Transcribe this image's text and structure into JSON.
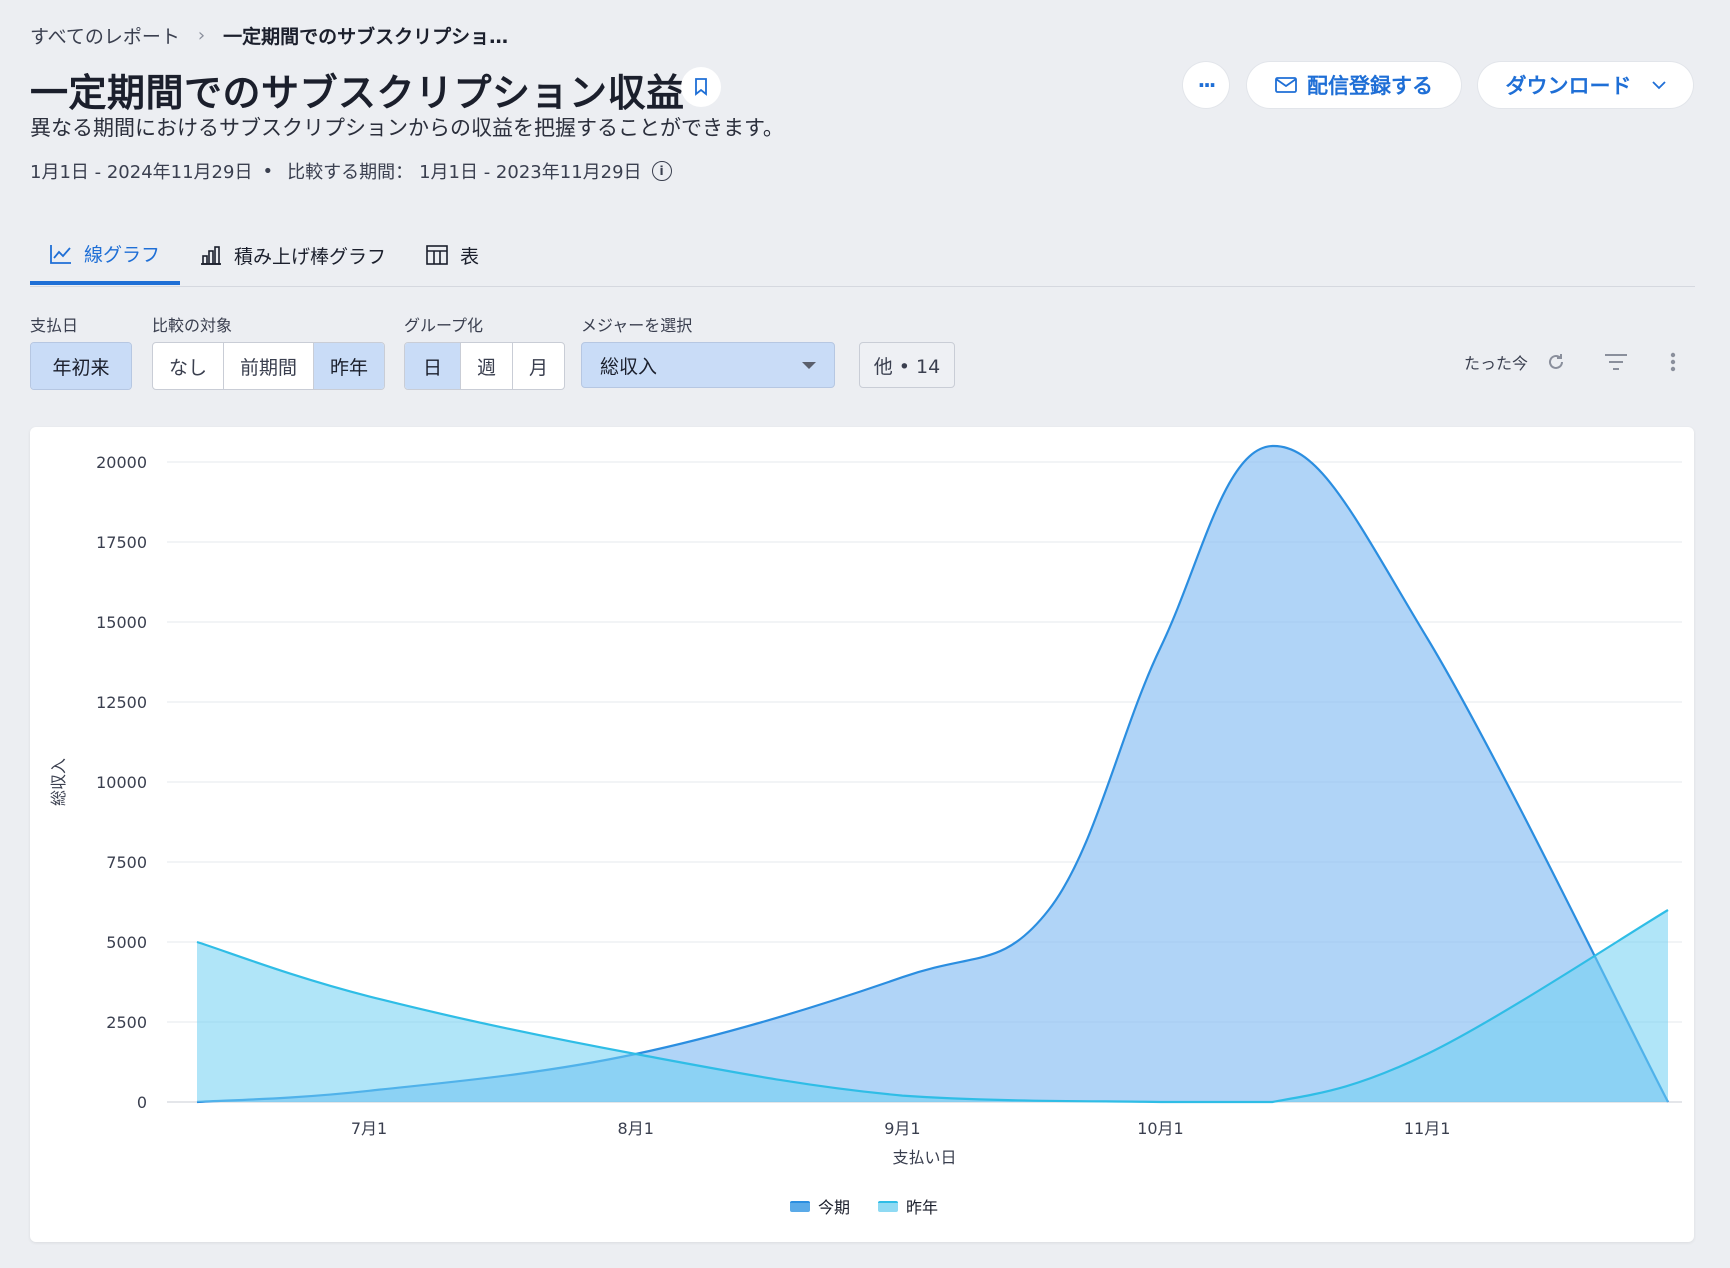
{
  "breadcrumb": {
    "root": "すべてのレポート",
    "current": "一定期間でのサブスクリプショ…"
  },
  "header": {
    "title": "一定期間でのサブスクリプション収益",
    "subtitle": "異なる期間におけるサブスクリプションからの収益を把握することができます。",
    "period": "1月1日 - 2024年11月29日",
    "compare_label": "比較する期間：",
    "compare_period": "1月1日 - 2023年11月29日",
    "more_label": "···",
    "subscribe_label": "配信登録する",
    "download_label": "ダウンロード"
  },
  "tabs": [
    {
      "label": "線グラフ",
      "icon": "line-chart-icon"
    },
    {
      "label": "積み上げ棒グラフ",
      "icon": "stacked-bar-icon"
    },
    {
      "label": "表",
      "icon": "table-icon"
    }
  ],
  "filters": {
    "payment_date": {
      "label": "支払日",
      "value": "年初来"
    },
    "compare": {
      "label": "比較の対象",
      "options": [
        "なし",
        "前期間",
        "昨年"
      ],
      "selected": "昨年"
    },
    "group": {
      "label": "グループ化",
      "options": [
        "日",
        "週",
        "月"
      ],
      "selected": "日"
    },
    "measure": {
      "label": "メジャーを選択",
      "value": "総収入"
    },
    "other": "他 • 14",
    "updated": "たった今"
  },
  "colors": {
    "accent": "#1f6fd6",
    "current": "#2b8ee0",
    "previous": "#2fbde6"
  },
  "chart_data": {
    "type": "area",
    "xlabel": "支払い日",
    "ylabel": "総収入",
    "ylim": [
      0,
      20000
    ],
    "yticks": [
      0,
      2500,
      5000,
      7500,
      10000,
      12500,
      15000,
      17500,
      20000
    ],
    "xticks": [
      {
        "label": "7月1",
        "date": "2024-07-01"
      },
      {
        "label": "8月1",
        "date": "2024-08-01"
      },
      {
        "label": "9月1",
        "date": "2024-09-01"
      },
      {
        "label": "10月1",
        "date": "2024-10-01"
      },
      {
        "label": "11月1",
        "date": "2024-11-01"
      }
    ],
    "series": [
      {
        "name": "今期",
        "points": [
          [
            "2024-06-11",
            0
          ],
          [
            "2024-07-01",
            350
          ],
          [
            "2024-08-01",
            1500
          ],
          [
            "2024-09-01",
            3900
          ],
          [
            "2024-09-18",
            6000
          ],
          [
            "2024-10-01",
            14200
          ],
          [
            "2024-10-14",
            20500
          ],
          [
            "2024-11-01",
            14500
          ],
          [
            "2024-11-29",
            0
          ]
        ]
      },
      {
        "name": "昨年",
        "points": [
          [
            "2024-06-11",
            5000
          ],
          [
            "2024-07-01",
            3300
          ],
          [
            "2024-08-01",
            1500
          ],
          [
            "2024-09-01",
            200
          ],
          [
            "2024-10-01",
            0
          ],
          [
            "2024-10-14",
            0
          ],
          [
            "2024-11-01",
            1500
          ],
          [
            "2024-11-29",
            6000
          ]
        ]
      }
    ]
  }
}
